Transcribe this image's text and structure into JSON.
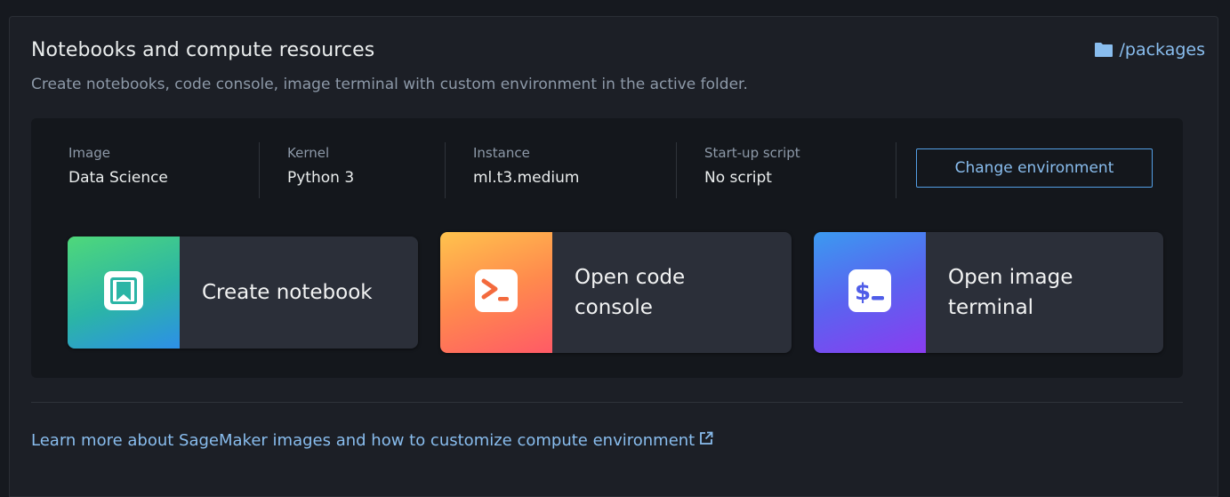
{
  "header": {
    "title": "Notebooks and compute resources",
    "subtitle": "Create notebooks, code console, image terminal with custom environment in the active folder.",
    "folder_icon": "folder-icon",
    "folder_path": "/packages"
  },
  "environment": {
    "items": [
      {
        "label": "Image",
        "value": "Data Science"
      },
      {
        "label": "Kernel",
        "value": "Python 3"
      },
      {
        "label": "Instance",
        "value": "ml.t3.medium"
      },
      {
        "label": "Start-up script",
        "value": "No script"
      }
    ],
    "change_button_label": "Change environment"
  },
  "actions": [
    {
      "label": "Create notebook",
      "icon": "notebook-icon",
      "gradient": [
        "#4fd87a",
        "#2d8fe8"
      ]
    },
    {
      "label": "Open code\nconsole",
      "icon": "code-console-icon",
      "gradient": [
        "#ffb84d",
        "#ff5a5a"
      ]
    },
    {
      "label": "Open image\nterminal",
      "icon": "terminal-icon",
      "gradient": [
        "#3b8ef0",
        "#7b3cf0"
      ]
    }
  ],
  "footer": {
    "learn_more_text": "Learn more about SageMaker images and how to customize compute environment",
    "external_icon": "external-link-icon"
  },
  "colors": {
    "background": "#16191f",
    "panel": "#1c1f26",
    "inner_panel": "#14171c",
    "card": "#2b2f39",
    "link": "#89bdee",
    "accent_border": "#539fe5"
  }
}
